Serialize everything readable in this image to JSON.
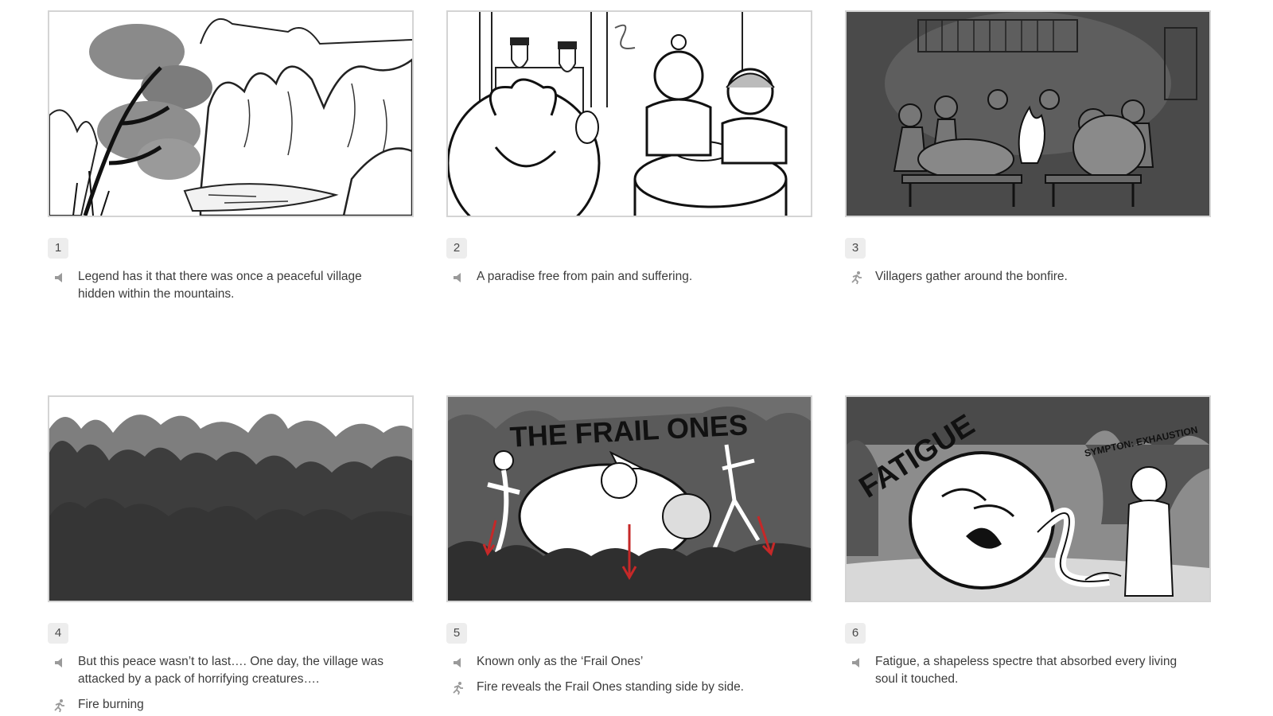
{
  "panels": [
    {
      "number": "1",
      "image": "mountain village landscape with trees and river",
      "lines": [
        {
          "icon": "speaker-icon",
          "text": "Legend has it that there was once a peaceful village hidden within the mountains."
        }
      ]
    },
    {
      "number": "2",
      "image": "villagers eating together at a round table",
      "lines": [
        {
          "icon": "speaker-icon",
          "text": "A paradise free from pain and suffering."
        }
      ]
    },
    {
      "number": "3",
      "image": "villagers gathered around a bonfire at night",
      "lines": [
        {
          "icon": "running-figure-icon",
          "text": "Villagers gather around the bonfire."
        }
      ]
    },
    {
      "number": "4",
      "image": "dark silhouettes of flames",
      "lines": [
        {
          "icon": "speaker-icon",
          "text": "But this peace wasn’t to last…. One day, the village was attacked by a pack of horrifying creatures…."
        },
        {
          "icon": "running-figure-icon",
          "text": "Fire burning"
        }
      ]
    },
    {
      "number": "5",
      "image": "monster creatures standing in front of fire",
      "lines": [
        {
          "icon": "speaker-icon",
          "text": "Known only as the ‘Frail Ones’"
        },
        {
          "icon": "running-figure-icon",
          "text": "Fire reveals the Frail Ones standing side by side."
        }
      ]
    },
    {
      "number": "6",
      "image": "giant spectre attacking villagers",
      "lines": [
        {
          "icon": "speaker-icon",
          "text": "Fatigue, a shapeless spectre that absorbed every living soul it touched."
        }
      ]
    }
  ],
  "drawn_text": {
    "panel5_title": "THE FRAIL ONES",
    "panel6_title": "FATIGUE",
    "panel6_caption": "SYMPTON: EXHAUSTION"
  },
  "colors": {
    "frame_border": "#d4d4d4",
    "badge_bg": "#ededed",
    "text": "#3c3c3c",
    "arrow_red": "#c62828"
  }
}
